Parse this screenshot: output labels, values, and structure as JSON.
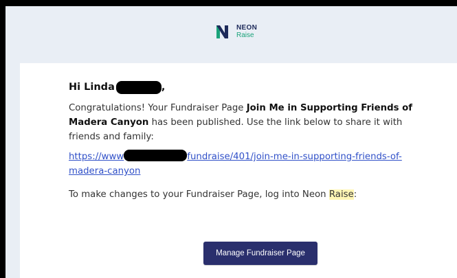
{
  "logo": {
    "brand_line1": "NEON",
    "brand_line2": "Raise",
    "colors": {
      "navy": "#1d2a5a",
      "green": "#1aa37a"
    }
  },
  "email": {
    "greeting_prefix": "Hi Linda",
    "greeting_suffix": ",",
    "congrats_before": "Congratulations! Your Fundraiser Page ",
    "page_title": "Join Me in Supporting Friends of Madera Canyon",
    "congrats_after": " has been published. Use the link below to share it with friends and family:",
    "link_start": "https://www",
    "link_end": "fundraise/401/join-me-in-supporting-friends-of-madera-canyon",
    "changes_before": "To make changes to your Fundraiser Page, log into Neon ",
    "changes_highlight": "Raise",
    "changes_after": ":",
    "button_label": "Manage Fundraiser Page"
  },
  "colors": {
    "background": "#e9eef5",
    "card": "#ffffff",
    "button": "#2a2f6d",
    "link": "#3050c8",
    "highlight": "#fff6b5"
  }
}
